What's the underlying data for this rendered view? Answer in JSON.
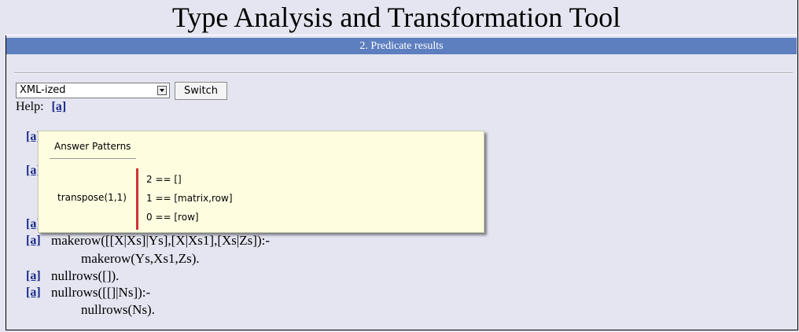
{
  "app": {
    "title": "Type Analysis and Transformation Tool",
    "section": "2. Predicate results"
  },
  "controls": {
    "view_select_value": "XML-ized",
    "switch_label": "Switch",
    "help_label": "Help:",
    "help_link": "[a]"
  },
  "clauses": {
    "links": [
      "[a]",
      "[a]",
      "[a]",
      "[a]",
      "[a]",
      "[a]"
    ],
    "makerow_head": "makerow([[X|Xs]|Ys],[X|Xs1],[Xs|Zs]):-",
    "makerow_body": "makerow(Ys,Xs1,Zs).",
    "nullrows_fact": "nullrows([]).",
    "nullrows_head": "nullrows([[]|Ns]):-",
    "nullrows_body": "nullrows(Ns)."
  },
  "popup": {
    "header": "Answer Patterns",
    "predicate": "transpose(1,1)",
    "patterns": [
      "2 == []",
      "1 == [matrix,row]",
      "0 == [row]"
    ]
  },
  "colors": {
    "section_bar": "#5e7fbf",
    "page_bg": "#e4e5f0",
    "popup_bg": "#fffde0",
    "link": "#1a2a8c",
    "popup_bar": "#cc3333"
  }
}
